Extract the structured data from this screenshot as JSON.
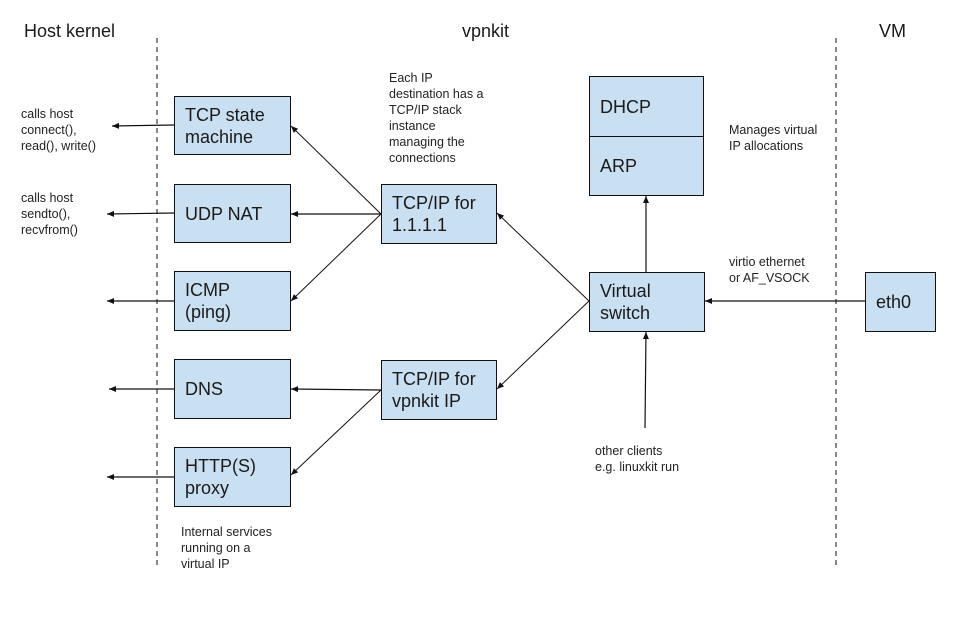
{
  "sections": {
    "host_kernel": "Host kernel",
    "vpnkit": "vpnkit",
    "vm": "VM"
  },
  "boxes": {
    "tcp_state_machine": "TCP state\nmachine",
    "udp_nat": "UDP NAT",
    "icmp": "ICMP\n(ping)",
    "dns": "DNS",
    "http_proxy": "HTTP(S)\nproxy",
    "tcpip_1111": "TCP/IP for\n1.1.1.1",
    "tcpip_vpnkit": "TCP/IP for\nvpnkit IP",
    "dhcp": "DHCP",
    "arp": "ARP",
    "virtual_switch": "Virtual\nswitch",
    "eth0": "eth0"
  },
  "notes": {
    "tcp_calls": "calls host\nconnect(),\nread(), write()",
    "udp_calls": "calls host\nsendto(),\nrecvfrom()",
    "each_ip": "Each IP\ndestination has a\nTCP/IP stack\ninstance\nmanaging the\nconnections",
    "manages_ip": "Manages virtual\nIP allocations",
    "virtio": "virtio ethernet\nor AF_VSOCK",
    "other_clients": "other clients\ne.g. linuxkit run",
    "internal_services": "Internal services\nrunning on a\nvirtual IP"
  },
  "colors": {
    "box_fill": "#c9dff2",
    "line": "#111111"
  }
}
